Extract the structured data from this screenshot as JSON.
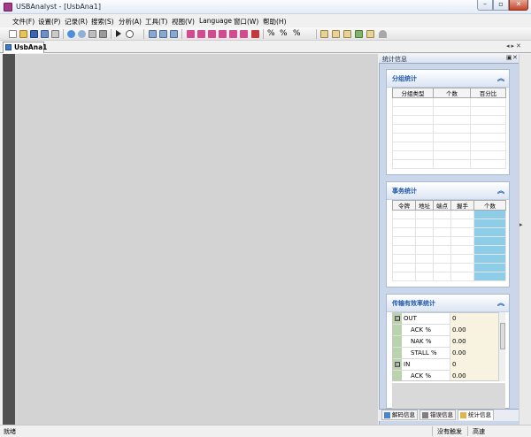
{
  "window": {
    "title": "USBAnalyst - [UsbAna1]"
  },
  "menu": [
    "文件(F)",
    "设置(P)",
    "记录(R)",
    "搜索(S)",
    "分析(A)",
    "工具(T)",
    "视图(V)",
    "Language",
    "窗口(W)",
    "帮助(H)"
  ],
  "doc_tab": {
    "label": "UsbAna1"
  },
  "panel": {
    "title": "统计信息"
  },
  "sections": {
    "group": {
      "title": "分组统计",
      "columns": [
        "分组类型",
        "个数",
        "百分比"
      ]
    },
    "transaction": {
      "title": "事务统计",
      "columns": [
        "令牌",
        "地址",
        "端点",
        "握手",
        "个数"
      ]
    },
    "efficiency": {
      "title": "传输有效率统计",
      "rows": [
        {
          "name": "OUT",
          "value": "0",
          "expander": "⊟"
        },
        {
          "name": "ACK %",
          "value": "0.00"
        },
        {
          "name": "NAK %",
          "value": "0.00"
        },
        {
          "name": "STALL %",
          "value": "0.00"
        },
        {
          "name": "IN",
          "value": "0",
          "expander": "⊟"
        },
        {
          "name": "ACK %",
          "value": "0.00"
        }
      ]
    }
  },
  "panel_tabs": [
    "解码信息",
    "错误信息",
    "统计信息"
  ],
  "status": {
    "left": "就绪",
    "trigger": "没有触发",
    "speed": "高速"
  },
  "colors": {
    "title_icon": "#a33a8c",
    "section_title": "#2158a8",
    "count_column": "#8ecde8",
    "panel_bg": "#cad7ea"
  }
}
